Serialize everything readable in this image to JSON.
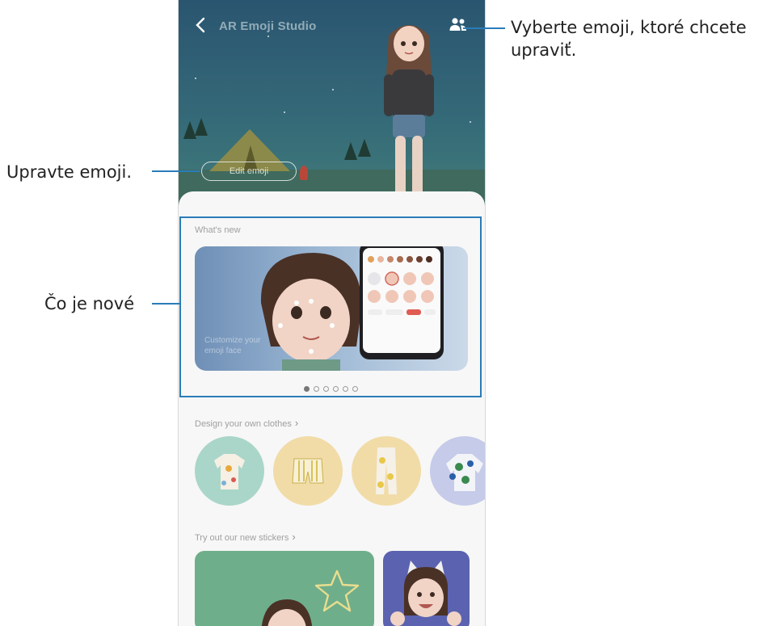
{
  "app": {
    "title": "AR Emoji Studio"
  },
  "header": {
    "edit_button_label": "Edit emoji"
  },
  "whats_new": {
    "label": "What's new",
    "banner_caption_line1": "Customize your",
    "banner_caption_line2": "emoji face",
    "pager_count": 6,
    "pager_active": 0
  },
  "clothes": {
    "label": "Design your own clothes"
  },
  "stickers": {
    "label": "Try out our new stickers"
  },
  "callouts": {
    "select_emoji": "Vyberte emoji, ktoré chcete upraviť.",
    "edit_emoji": "Upravte emoji.",
    "whats_new": "Čo je nové"
  },
  "colors": {
    "callout_line": "#2a7cb8",
    "sky_top": "#2a5570",
    "ground": "#3f6a5d",
    "cloth_1": "#a9d6c9",
    "cloth_2": "#f1dca8",
    "cloth_3": "#f1dca8",
    "cloth_4": "#c6cbe9",
    "sticker_1": "#6fae8a",
    "sticker_2": "#5b62b0"
  },
  "icons": {
    "back": "chevron-left-icon",
    "people": "people-icon",
    "stars": "star-outline-icon"
  }
}
